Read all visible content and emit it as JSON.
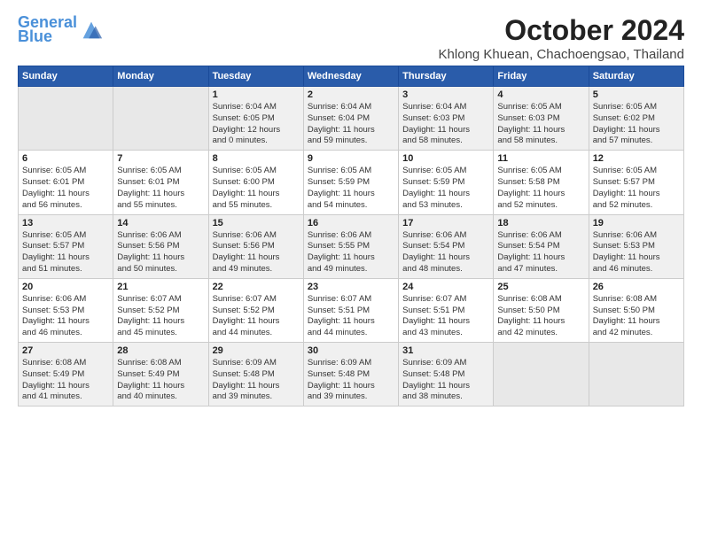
{
  "logo": {
    "line1": "General",
    "line2": "Blue"
  },
  "title": "October 2024",
  "subtitle": "Khlong Khuean, Chachoengsao, Thailand",
  "days_of_week": [
    "Sunday",
    "Monday",
    "Tuesday",
    "Wednesday",
    "Thursday",
    "Friday",
    "Saturday"
  ],
  "weeks": [
    [
      {
        "day": "",
        "info": ""
      },
      {
        "day": "",
        "info": ""
      },
      {
        "day": "1",
        "info": "Sunrise: 6:04 AM\nSunset: 6:05 PM\nDaylight: 12 hours\nand 0 minutes."
      },
      {
        "day": "2",
        "info": "Sunrise: 6:04 AM\nSunset: 6:04 PM\nDaylight: 11 hours\nand 59 minutes."
      },
      {
        "day": "3",
        "info": "Sunrise: 6:04 AM\nSunset: 6:03 PM\nDaylight: 11 hours\nand 58 minutes."
      },
      {
        "day": "4",
        "info": "Sunrise: 6:05 AM\nSunset: 6:03 PM\nDaylight: 11 hours\nand 58 minutes."
      },
      {
        "day": "5",
        "info": "Sunrise: 6:05 AM\nSunset: 6:02 PM\nDaylight: 11 hours\nand 57 minutes."
      }
    ],
    [
      {
        "day": "6",
        "info": "Sunrise: 6:05 AM\nSunset: 6:01 PM\nDaylight: 11 hours\nand 56 minutes."
      },
      {
        "day": "7",
        "info": "Sunrise: 6:05 AM\nSunset: 6:01 PM\nDaylight: 11 hours\nand 55 minutes."
      },
      {
        "day": "8",
        "info": "Sunrise: 6:05 AM\nSunset: 6:00 PM\nDaylight: 11 hours\nand 55 minutes."
      },
      {
        "day": "9",
        "info": "Sunrise: 6:05 AM\nSunset: 5:59 PM\nDaylight: 11 hours\nand 54 minutes."
      },
      {
        "day": "10",
        "info": "Sunrise: 6:05 AM\nSunset: 5:59 PM\nDaylight: 11 hours\nand 53 minutes."
      },
      {
        "day": "11",
        "info": "Sunrise: 6:05 AM\nSunset: 5:58 PM\nDaylight: 11 hours\nand 52 minutes."
      },
      {
        "day": "12",
        "info": "Sunrise: 6:05 AM\nSunset: 5:57 PM\nDaylight: 11 hours\nand 52 minutes."
      }
    ],
    [
      {
        "day": "13",
        "info": "Sunrise: 6:05 AM\nSunset: 5:57 PM\nDaylight: 11 hours\nand 51 minutes."
      },
      {
        "day": "14",
        "info": "Sunrise: 6:06 AM\nSunset: 5:56 PM\nDaylight: 11 hours\nand 50 minutes."
      },
      {
        "day": "15",
        "info": "Sunrise: 6:06 AM\nSunset: 5:56 PM\nDaylight: 11 hours\nand 49 minutes."
      },
      {
        "day": "16",
        "info": "Sunrise: 6:06 AM\nSunset: 5:55 PM\nDaylight: 11 hours\nand 49 minutes."
      },
      {
        "day": "17",
        "info": "Sunrise: 6:06 AM\nSunset: 5:54 PM\nDaylight: 11 hours\nand 48 minutes."
      },
      {
        "day": "18",
        "info": "Sunrise: 6:06 AM\nSunset: 5:54 PM\nDaylight: 11 hours\nand 47 minutes."
      },
      {
        "day": "19",
        "info": "Sunrise: 6:06 AM\nSunset: 5:53 PM\nDaylight: 11 hours\nand 46 minutes."
      }
    ],
    [
      {
        "day": "20",
        "info": "Sunrise: 6:06 AM\nSunset: 5:53 PM\nDaylight: 11 hours\nand 46 minutes."
      },
      {
        "day": "21",
        "info": "Sunrise: 6:07 AM\nSunset: 5:52 PM\nDaylight: 11 hours\nand 45 minutes."
      },
      {
        "day": "22",
        "info": "Sunrise: 6:07 AM\nSunset: 5:52 PM\nDaylight: 11 hours\nand 44 minutes."
      },
      {
        "day": "23",
        "info": "Sunrise: 6:07 AM\nSunset: 5:51 PM\nDaylight: 11 hours\nand 44 minutes."
      },
      {
        "day": "24",
        "info": "Sunrise: 6:07 AM\nSunset: 5:51 PM\nDaylight: 11 hours\nand 43 minutes."
      },
      {
        "day": "25",
        "info": "Sunrise: 6:08 AM\nSunset: 5:50 PM\nDaylight: 11 hours\nand 42 minutes."
      },
      {
        "day": "26",
        "info": "Sunrise: 6:08 AM\nSunset: 5:50 PM\nDaylight: 11 hours\nand 42 minutes."
      }
    ],
    [
      {
        "day": "27",
        "info": "Sunrise: 6:08 AM\nSunset: 5:49 PM\nDaylight: 11 hours\nand 41 minutes."
      },
      {
        "day": "28",
        "info": "Sunrise: 6:08 AM\nSunset: 5:49 PM\nDaylight: 11 hours\nand 40 minutes."
      },
      {
        "day": "29",
        "info": "Sunrise: 6:09 AM\nSunset: 5:48 PM\nDaylight: 11 hours\nand 39 minutes."
      },
      {
        "day": "30",
        "info": "Sunrise: 6:09 AM\nSunset: 5:48 PM\nDaylight: 11 hours\nand 39 minutes."
      },
      {
        "day": "31",
        "info": "Sunrise: 6:09 AM\nSunset: 5:48 PM\nDaylight: 11 hours\nand 38 minutes."
      },
      {
        "day": "",
        "info": ""
      },
      {
        "day": "",
        "info": ""
      }
    ]
  ]
}
